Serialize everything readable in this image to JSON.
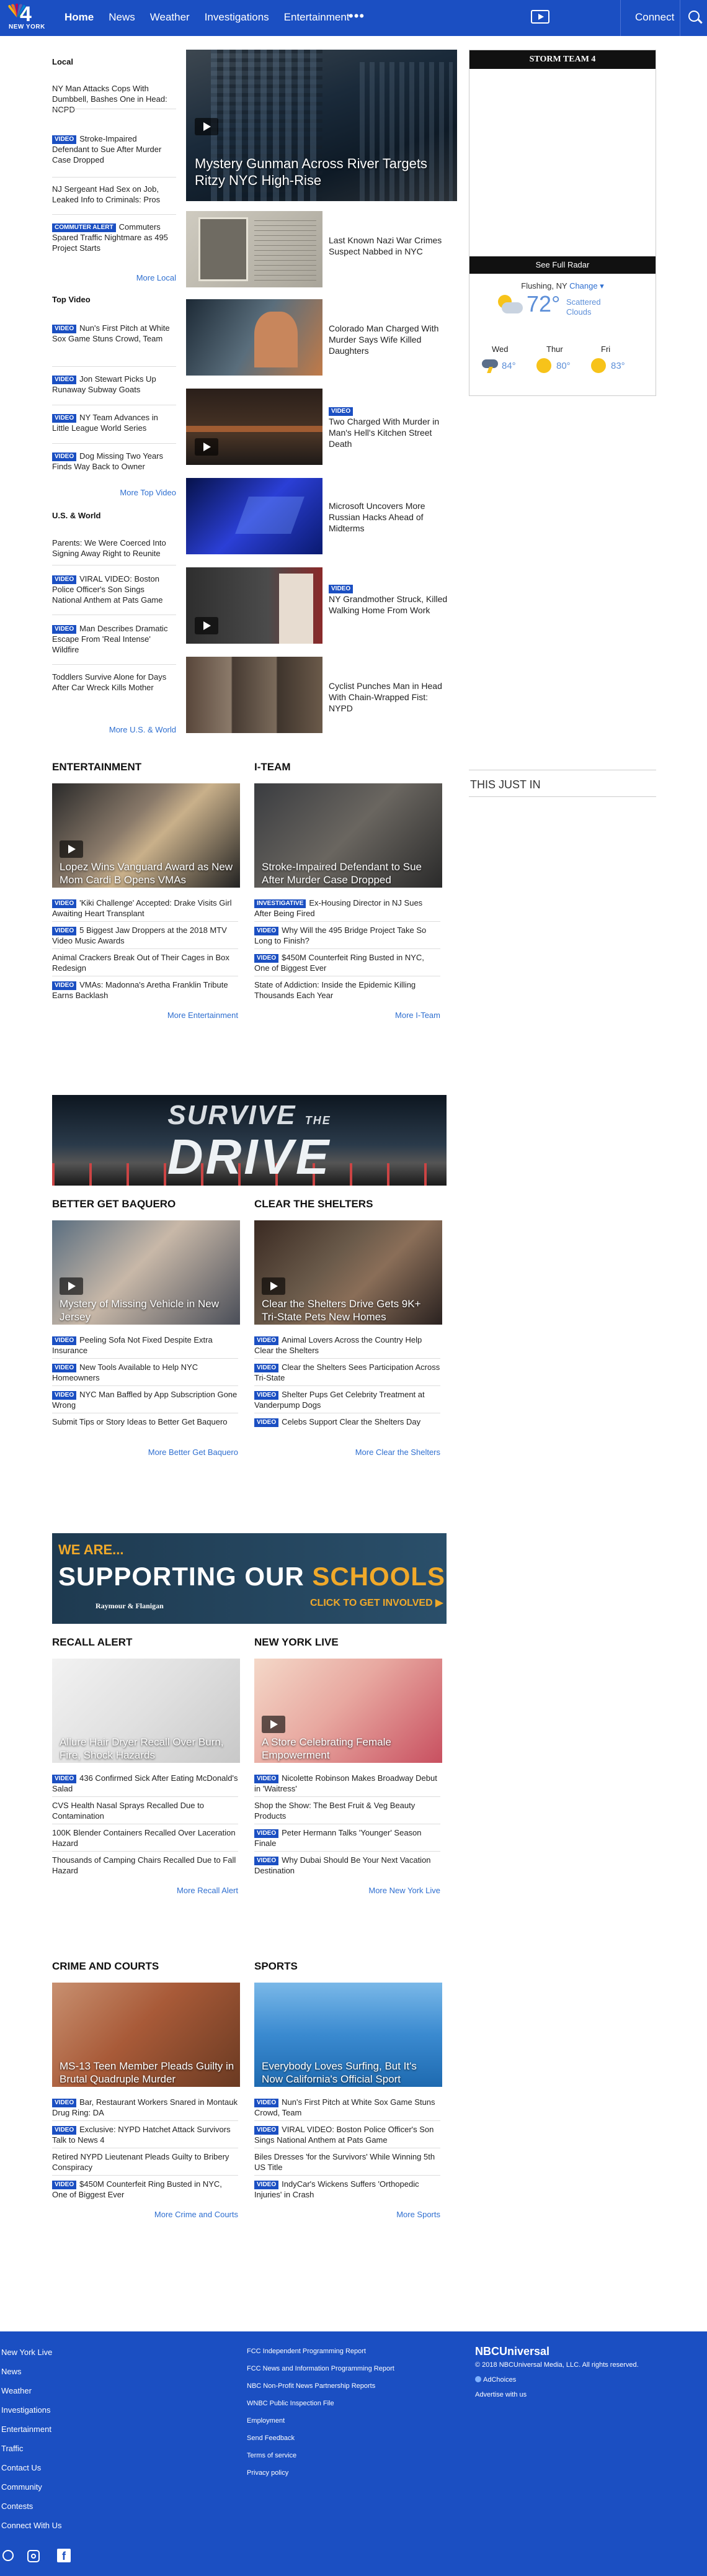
{
  "nav": {
    "logo_text": "NEW YORK",
    "items": [
      "Home",
      "News",
      "Weather",
      "Investigations",
      "Entertainment"
    ],
    "more": "•••",
    "connect": "Connect"
  },
  "local": {
    "title": "Local",
    "items": [
      {
        "badge": "",
        "text": "NY Man Attacks Cops With Dumbbell, Bashes One in Head: NCPD"
      },
      {
        "badge": "VIDEO",
        "text": "Stroke-Impaired Defendant to Sue After Murder Case Dropped"
      },
      {
        "badge": "",
        "text": "NJ Sergeant Had Sex on Job, Leaked Info to Criminals: Pros"
      },
      {
        "badge": "COMMUTER ALERT",
        "text": "Commuters Spared Traffic Nightmare as 495 Project Starts"
      }
    ],
    "more": "More Local"
  },
  "top_video": {
    "title": "Top Video",
    "items": [
      {
        "badge": "VIDEO",
        "text": "Nun's First Pitch at White Sox Game Stuns Crowd, Team"
      },
      {
        "badge": "VIDEO",
        "text": "Jon Stewart Picks Up Runaway Subway Goats"
      },
      {
        "badge": "VIDEO",
        "text": "NY Team Advances in Little League World Series"
      },
      {
        "badge": "VIDEO",
        "text": "Dog Missing Two Years Finds Way Back to Owner"
      }
    ],
    "more": "More Top Video"
  },
  "us_world": {
    "title": "U.S. & World",
    "items": [
      {
        "badge": "",
        "text": "Parents: We Were Coerced Into Signing Away Right to Reunite"
      },
      {
        "badge": "VIDEO",
        "text": "VIRAL VIDEO: Boston Police Officer's Son Sings National Anthem at Pats Game"
      },
      {
        "badge": "VIDEO",
        "text": "Man Describes Dramatic Escape From 'Real Intense' Wildfire"
      },
      {
        "badge": "",
        "text": "Toddlers Survive Alone for Days After Car Wreck Kills Mother"
      }
    ],
    "more": "More U.S. & World"
  },
  "lead": {
    "headline": "Mystery Gunman Across River Targets Ritzy NYC High-Rise"
  },
  "stories": [
    {
      "badge": "",
      "text": "Last Known Nazi War Crimes Suspect Nabbed in NYC"
    },
    {
      "badge": "",
      "text": "Colorado Man Charged With Murder Says Wife Killed Daughters"
    },
    {
      "badge": "VIDEO",
      "text": "Two Charged With Murder in Man's Hell's Kitchen Street Death"
    },
    {
      "badge": "",
      "text": "Microsoft Uncovers More Russian Hacks Ahead of Midterms"
    },
    {
      "badge": "VIDEO",
      "text": "NY Grandmother Struck, Killed Walking Home From Work"
    },
    {
      "badge": "",
      "text": "Cyclist Punches Man in Head With Chain-Wrapped Fist: NYPD"
    }
  ],
  "weather": {
    "brand": "STORM TEAM 4",
    "radar": "See Full Radar",
    "location": "Flushing, NY",
    "change": "Change",
    "temp": "72°",
    "cond": "Scattered Clouds",
    "days": [
      {
        "d": "Wed",
        "t": "84°"
      },
      {
        "d": "Thur",
        "t": "80°"
      },
      {
        "d": "Fri",
        "t": "83°"
      }
    ]
  },
  "this_just_in": "THIS JUST IN",
  "sections": [
    {
      "title": "ENTERTAINMENT",
      "lead": "Lopez Wins Vanguard Award as New Mom Cardi B Opens VMAs",
      "items": [
        {
          "badge": "VIDEO",
          "text": "'Kiki Challenge' Accepted: Drake Visits Girl Awaiting Heart Transplant"
        },
        {
          "badge": "VIDEO",
          "text": "5 Biggest Jaw Droppers at the 2018 MTV Video Music Awards"
        },
        {
          "badge": "",
          "text": "Animal Crackers Break Out of Their Cages in Box Redesign"
        },
        {
          "badge": "VIDEO",
          "text": "VMAs: Madonna's Aretha Franklin Tribute Earns Backlash"
        }
      ],
      "more": "More Entertainment"
    },
    {
      "title": "I-TEAM",
      "lead": "Stroke-Impaired Defendant to Sue After Murder Case Dropped",
      "items": [
        {
          "badge": "INVESTIGATIVE",
          "text": "Ex-Housing Director in NJ Sues After Being Fired"
        },
        {
          "badge": "VIDEO",
          "text": "Why Will the 495 Bridge Project Take So Long to Finish?"
        },
        {
          "badge": "VIDEO",
          "text": "$450M Counterfeit Ring Busted in NYC, One of Biggest Ever"
        },
        {
          "badge": "",
          "text": "State of Addiction: Inside the Epidemic Killing Thousands Each Year"
        }
      ],
      "more": "More I-Team"
    },
    {
      "title": "BETTER GET BAQUERO",
      "lead": "Mystery of Missing Vehicle in New Jersey",
      "items": [
        {
          "badge": "VIDEO",
          "text": "Peeling Sofa Not Fixed Despite Extra Insurance"
        },
        {
          "badge": "VIDEO",
          "text": "New Tools Available to Help NYC Homeowners"
        },
        {
          "badge": "VIDEO",
          "text": "NYC Man Baffled by App Subscription Gone Wrong"
        },
        {
          "badge": "",
          "text": "Submit Tips or Story Ideas to Better Get Baquero"
        }
      ],
      "more": "More Better Get Baquero"
    },
    {
      "title": "CLEAR THE SHELTERS",
      "lead": "Clear the Shelters Drive Gets 9K+ Tri-State Pets New Homes",
      "items": [
        {
          "badge": "VIDEO",
          "text": "Animal Lovers Across the Country Help Clear the Shelters"
        },
        {
          "badge": "VIDEO",
          "text": "Clear the Shelters Sees Participation Across Tri-State"
        },
        {
          "badge": "VIDEO",
          "text": "Shelter Pups Get Celebrity Treatment at Vanderpump Dogs"
        },
        {
          "badge": "VIDEO",
          "text": "Celebs Support Clear the Shelters Day"
        }
      ],
      "more": "More Clear the Shelters"
    },
    {
      "title": "RECALL ALERT",
      "lead": "Allure Hair Dryer Recall Over Burn, Fire, Shock Hazards",
      "items": [
        {
          "badge": "VIDEO",
          "text": "436 Confirmed Sick After Eating McDonald's Salad"
        },
        {
          "badge": "",
          "text": "CVS Health Nasal Sprays Recalled Due to Contamination"
        },
        {
          "badge": "",
          "text": "100K Blender Containers Recalled Over Laceration Hazard"
        },
        {
          "badge": "",
          "text": "Thousands of Camping Chairs Recalled Due to Fall Hazard"
        }
      ],
      "more": "More Recall Alert"
    },
    {
      "title": "NEW YORK LIVE",
      "lead": "A Store Celebrating Female Empowerment",
      "items": [
        {
          "badge": "VIDEO",
          "text": "Nicolette Robinson Makes Broadway Debut in 'Waitress'"
        },
        {
          "badge": "",
          "text": "Shop the Show: The Best Fruit & Veg Beauty Products"
        },
        {
          "badge": "VIDEO",
          "text": "Peter Hermann Talks 'Younger' Season Finale"
        },
        {
          "badge": "VIDEO",
          "text": "Why Dubai Should Be Your Next Vacation Destination"
        }
      ],
      "more": "More New York Live"
    },
    {
      "title": "CRIME AND COURTS",
      "lead": "MS-13 Teen Member Pleads Guilty in Brutal Quadruple Murder",
      "items": [
        {
          "badge": "VIDEO",
          "text": "Bar, Restaurant Workers Snared in Montauk Drug Ring: DA"
        },
        {
          "badge": "VIDEO",
          "text": "Exclusive: NYPD Hatchet Attack Survivors Talk to News 4"
        },
        {
          "badge": "",
          "text": "Retired NYPD Lieutenant Pleads Guilty to Bribery Conspiracy"
        },
        {
          "badge": "VIDEO",
          "text": "$450M Counterfeit Ring Busted in NYC, One of Biggest Ever"
        }
      ],
      "more": "More Crime and Courts"
    },
    {
      "title": "SPORTS",
      "lead": "Everybody Loves Surfing, But It's Now California's Official Sport",
      "items": [
        {
          "badge": "VIDEO",
          "text": "Nun's First Pitch at White Sox Game Stuns Crowd, Team"
        },
        {
          "badge": "VIDEO",
          "text": "VIRAL VIDEO: Boston Police Officer's Son Sings National Anthem at Pats Game"
        },
        {
          "badge": "",
          "text": "Biles Dresses 'for the Survivors' While Winning 5th US Title"
        },
        {
          "badge": "VIDEO",
          "text": "IndyCar's Wickens Suffers 'Orthopedic Injuries' in Crash"
        }
      ],
      "more": "More Sports"
    }
  ],
  "banner1": {
    "line1": "SURVIVE",
    "line2": "THE",
    "line3": "DRIVE"
  },
  "banner2": {
    "line1": "WE ARE...",
    "line2": "SUPPORTING OUR",
    "line3": "SCHOOLS",
    "cta": "CLICK TO GET INVOLVED ▶",
    "sponsor": "Raymour & Flanigan"
  },
  "footer": {
    "col1": [
      "New York Live",
      "News",
      "Weather",
      "Investigations",
      "Entertainment",
      "Traffic",
      "Contact Us",
      "Community",
      "Contests",
      "Connect With Us"
    ],
    "col2": [
      "FCC Independent Programming Report",
      "FCC News and Information Programming Report",
      "NBC Non-Profit News Partnership Reports",
      "WNBC Public Inspection File",
      "Employment",
      "Send Feedback",
      "Terms of service",
      "Privacy policy"
    ],
    "brand": "NBCUniversal",
    "copyright": "© 2018 NBCUniversal Media, LLC. All rights reserved.",
    "adchoices": "AdChoices",
    "advertise": "Advertise with us"
  },
  "colors": {
    "brand_blue": "#1b4fc2",
    "link_blue": "#2f6fd0"
  }
}
